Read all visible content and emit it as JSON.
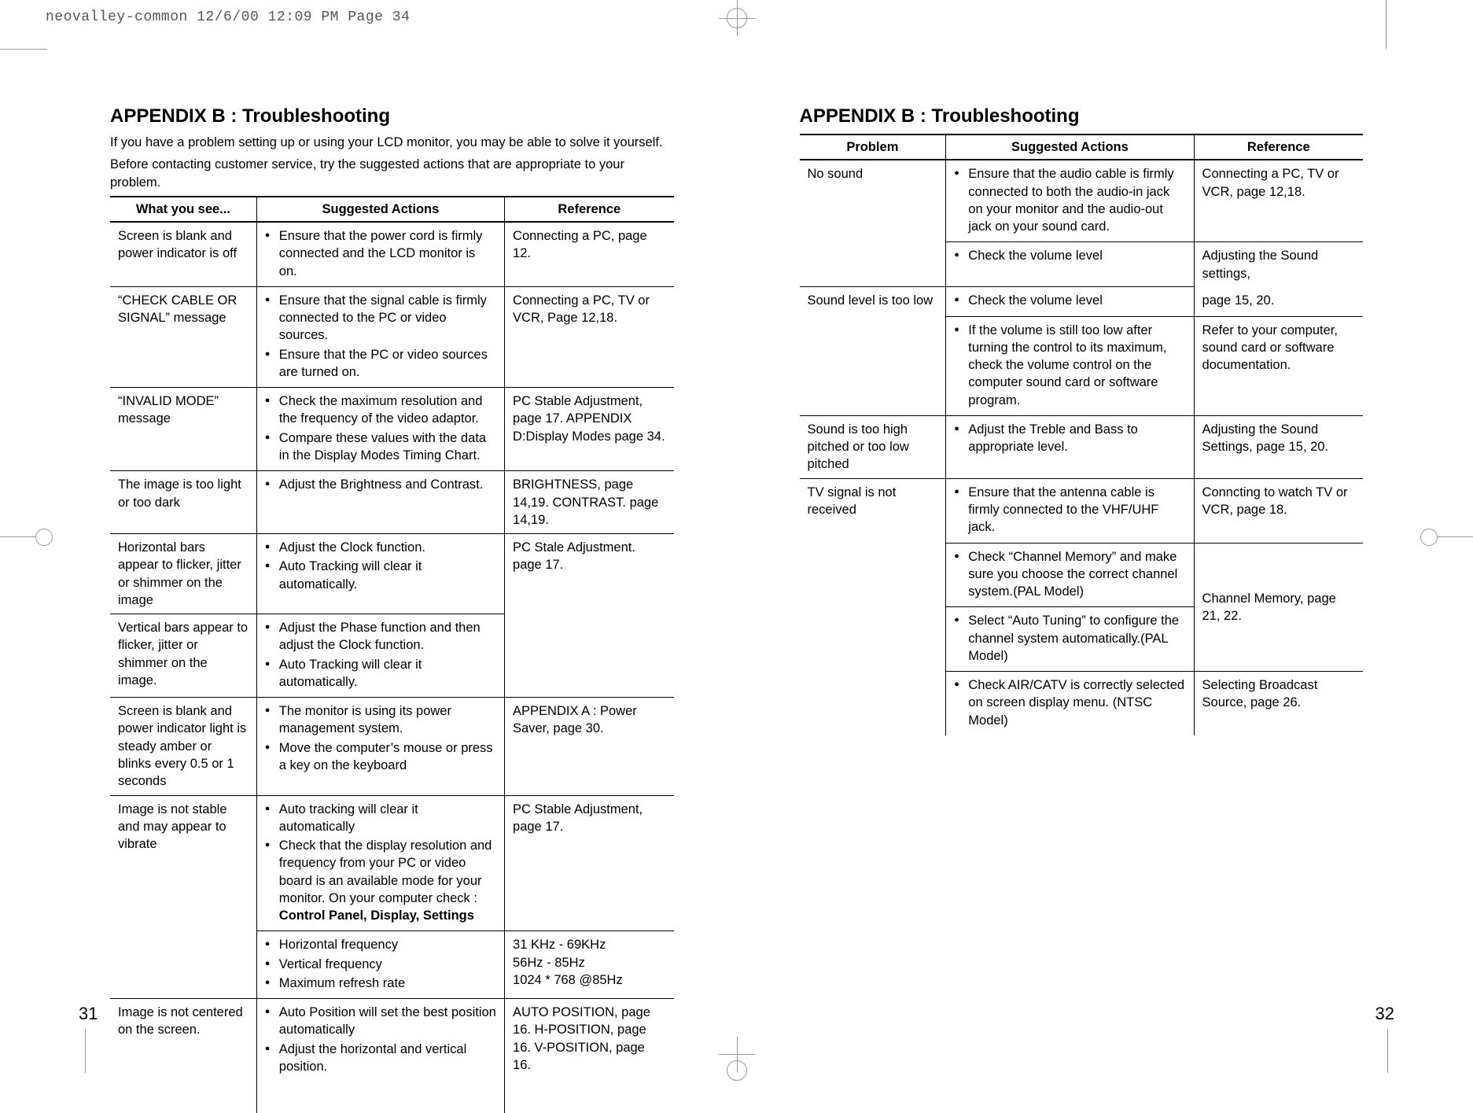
{
  "slug": "neovalley-common  12/6/00  12:09 PM  Page 34",
  "left": {
    "title": "APPENDIX B : Troubleshooting",
    "intro1": "If you have a problem setting up or using your LCD monitor, you may be able to solve it yourself.",
    "intro2": "Before contacting customer service, try the suggested actions that are appropriate to your problem.",
    "headers": {
      "c1": "What you see...",
      "c2": "Suggested Actions",
      "c3": "Reference"
    },
    "rows": [
      {
        "problem": "Screen is blank and power indicator is off",
        "actions": [
          "Ensure that the power cord is firmly connected and the LCD monitor is on."
        ],
        "ref": "Connecting a PC, page 12.",
        "top": true
      },
      {
        "problem": "“CHECK CABLE OR SIGNAL” message",
        "actions": [
          "Ensure that the signal cable is firmly connected to the PC or video sources.",
          "Ensure that the PC or video sources are turned on."
        ],
        "ref": "Connecting a PC, TV or VCR, Page 12,18.",
        "top": true
      },
      {
        "problem": "“INVALID MODE” message",
        "actions": [
          "Check the maximum resolution and the frequency of the video adaptor.",
          "Compare these values with the data in the Display Modes Timing Chart."
        ],
        "ref": "PC Stable Adjustment, page 17. APPENDIX D:Display Modes page 34.",
        "top": true
      },
      {
        "problem": "The image is too light or too dark",
        "actions": [
          "Adjust the Brightness and Contrast."
        ],
        "ref": "BRIGHTNESS, page 14,19. CONTRAST. page 14,19.",
        "top": true
      },
      {
        "problem": "Horizontal bars appear to flicker, jitter or shimmer on the image",
        "actions": [
          "Adjust the Clock function.",
          "Auto Tracking will clear it automatically."
        ],
        "ref": "PC Stale Adjustment. page 17.",
        "top": true
      },
      {
        "problem": "Vertical bars appear to flicker, jitter or shimmer on the image.",
        "actions": [
          "Adjust the Phase function and then adjust the Clock function.",
          "Auto Tracking will clear it automatically."
        ],
        "ref": "",
        "top": true,
        "refBorderTop": false
      },
      {
        "problem": "Screen is blank and power indicator light is steady amber or blinks every 0.5 or 1 seconds",
        "actions": [
          "The monitor is using its power management system.",
          "Move the computer’s mouse or press a key on the keyboard"
        ],
        "ref": "APPENDIX A : Power Saver, page 30.",
        "top": true
      },
      {
        "problem": "Image is not stable and may appear to vibrate",
        "actions": [
          "Auto tracking will clear it automatically",
          "Check that the display resolution and frequency from your PC or video board is an available mode for your monitor. On your computer check : <b>Control Panel, Display, Settings</b>"
        ],
        "ref": "PC Stable Adjustment, page 17.",
        "top": true
      },
      {
        "problem": "",
        "actions": [
          "Horizontal frequency",
          "Vertical frequency",
          "Maximum refresh rate"
        ],
        "ref": "31 KHz - 69KHz\n56Hz - 85Hz\n1024 * 768 @85Hz",
        "top": true,
        "problemBorderTop": false
      },
      {
        "problem": "Image is not centered on the screen.",
        "actions": [
          "Auto Position will set the best position automatically",
          "Adjust the horizontal and vertical position."
        ],
        "ref": "AUTO POSITION, page 16. H-POSITION, page 16. V-POSITION, page 16.",
        "top": true
      }
    ],
    "pageNum": "31"
  },
  "right": {
    "title": "APPENDIX B : Troubleshooting",
    "headers": {
      "c1": "Problem",
      "c2": "Suggested Actions",
      "c3": "Reference"
    },
    "rows": [
      {
        "problem": "No sound",
        "actions": [
          "Ensure that the audio cable is firmly connected to both the audio-in jack on your monitor and the audio-out jack on your sound card."
        ],
        "ref": "Connecting a PC, TV or VCR, page 12,18.",
        "top": true
      },
      {
        "problem": "",
        "actions": [
          "Check the volume level"
        ],
        "ref": "Adjusting the Sound settings,",
        "top": true,
        "problemBorderTop": false
      },
      {
        "problem": "Sound level is too low",
        "actions": [
          "Check the volume level"
        ],
        "ref": "page 15, 20.",
        "top": true,
        "refBorderTop": false
      },
      {
        "problem": "",
        "actions": [
          "If the volume is still too low after turning the control to its maximum, check the volume control on the computer sound card or software program."
        ],
        "ref": "Refer to your computer, sound card or software documentation.",
        "top": true,
        "problemBorderTop": false
      },
      {
        "problem": "Sound is too high pitched or too low pitched",
        "actions": [
          "Adjust the Treble and Bass to appropriate level."
        ],
        "ref": "Adjusting the Sound Settings, page 15, 20.",
        "top": true
      },
      {
        "problem": "TV signal is not received",
        "actions": [
          "Ensure that the antenna cable is firmly connected to the VHF/UHF jack."
        ],
        "ref": "Conncting to watch TV or VCR, page 18.",
        "top": true
      },
      {
        "problem": "",
        "actions": [
          "Check “Channel Memory” and make sure you choose the correct channel system.(PAL Model)"
        ],
        "ref": "",
        "top": true,
        "problemBorderTop": false,
        "refRowSpan": 2,
        "refText": "Channel Memory, page 21, 22."
      },
      {
        "problem": "",
        "actions": [
          "Select “Auto Tuning” to configure the channel system automatically.(PAL Model)"
        ],
        "ref": "__ROWSPAN__",
        "top": true,
        "problemBorderTop": false
      },
      {
        "problem": "",
        "actions": [
          "Check AIR/CATV is correctly selected on screen display menu. (NTSC Model)"
        ],
        "ref": "Selecting Broadcast Source, page 26.",
        "top": true,
        "problemBorderTop": false
      }
    ],
    "pageNum": "32"
  }
}
